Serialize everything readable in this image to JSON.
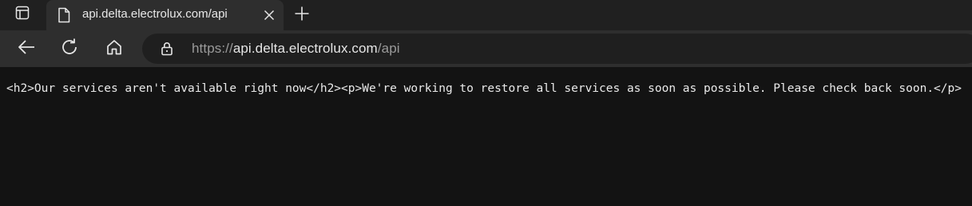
{
  "browser": {
    "tab": {
      "title": "api.delta.electrolux.com/api",
      "favicon": "page-icon"
    },
    "address_bar": {
      "scheme": "https://",
      "host": "api.delta.electrolux.com",
      "path": "/api",
      "security_icon": "lock-icon"
    },
    "icons": {
      "tab_actions": "tab-actions-icon",
      "close": "close-icon",
      "new_tab": "plus-icon",
      "back": "back-arrow-icon",
      "refresh": "refresh-icon",
      "home": "home-icon"
    },
    "colors": {
      "page_background": "#131313",
      "toolbar_background": "#2e2e2e",
      "tabstrip_background": "#202020",
      "text": "#e9e9e9"
    }
  },
  "page": {
    "body_text": "<h2>Our services aren't available right now</h2><p>We're working to restore all services as soon as possible. Please check back soon.</p>"
  }
}
